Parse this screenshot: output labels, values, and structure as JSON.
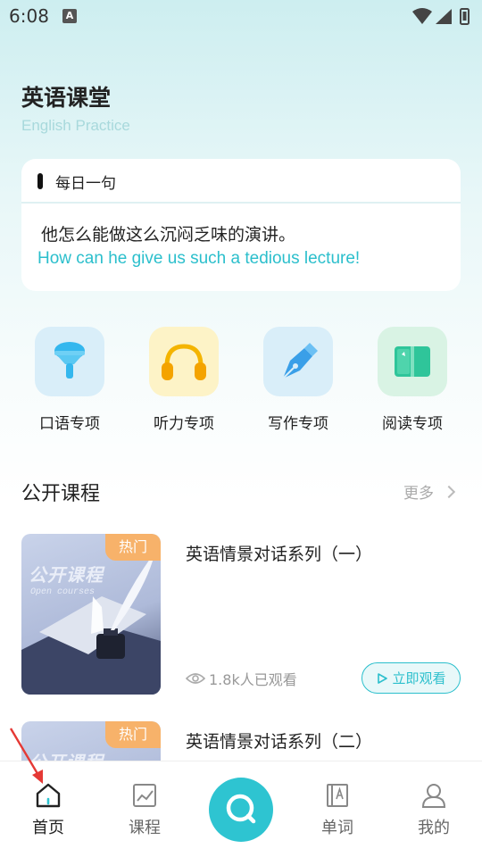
{
  "status_bar": {
    "time": "6:08",
    "notification_icon": "A"
  },
  "header": {
    "title": "英语课堂",
    "subtitle": "English Practice"
  },
  "daily": {
    "label": "每日一句",
    "chinese": "他怎么能做这么沉闷乏味的演讲。",
    "english": "How can he give us such a tedious lecture!"
  },
  "categories": [
    {
      "label": "口语专项",
      "icon": "microphone-icon",
      "bg": "#d9eef9"
    },
    {
      "label": "听力专项",
      "icon": "headphones-icon",
      "bg": "#fdf3c7"
    },
    {
      "label": "写作专项",
      "icon": "pen-nib-icon",
      "bg": "#d9eef9"
    },
    {
      "label": "阅读专项",
      "icon": "book-icon",
      "bg": "#d9f3e4"
    }
  ],
  "section": {
    "title": "公开课程",
    "more": "更多"
  },
  "courses": [
    {
      "tag": "热门",
      "thumb_title": "公开课程",
      "thumb_subtitle": "Open courses",
      "title": "英语情景对话系列（一）",
      "views": "1.8k人已观看",
      "button": "立即观看"
    },
    {
      "tag": "热门",
      "thumb_title": "公开课程",
      "title": "英语情景对话系列（二）"
    }
  ],
  "nav": {
    "items": [
      {
        "label": "首页",
        "icon": "home-icon"
      },
      {
        "label": "课程",
        "icon": "chart-icon"
      },
      {
        "label": "",
        "icon": "search-icon"
      },
      {
        "label": "单词",
        "icon": "dictionary-icon"
      },
      {
        "label": "我的",
        "icon": "profile-icon"
      }
    ],
    "active": "首页"
  },
  "colors": {
    "accent": "#2ec4d1",
    "hot_tag": "#f7b26a",
    "annotation": "#e53935"
  }
}
